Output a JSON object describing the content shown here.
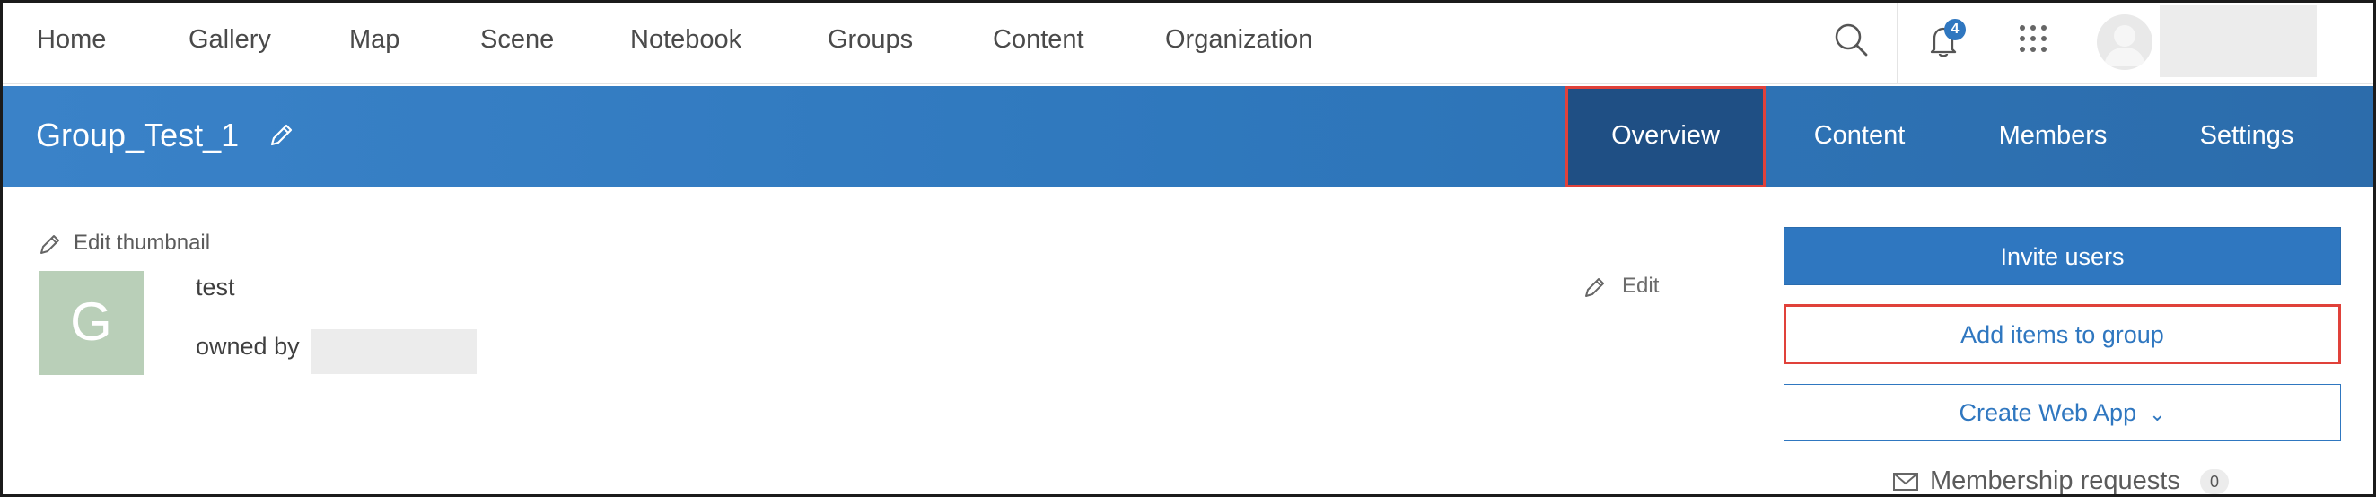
{
  "topnav": {
    "items": [
      {
        "label": "Home"
      },
      {
        "label": "Gallery"
      },
      {
        "label": "Map"
      },
      {
        "label": "Scene"
      },
      {
        "label": "Notebook"
      },
      {
        "label": "Groups"
      },
      {
        "label": "Content"
      },
      {
        "label": "Organization"
      }
    ],
    "notification_count": "4",
    "icons": [
      "search-icon",
      "bell-icon",
      "app-launcher-icon",
      "user-avatar-icon"
    ]
  },
  "group": {
    "title": "Group_Test_1",
    "tabs": [
      {
        "label": "Overview",
        "active": true
      },
      {
        "label": "Content",
        "active": false
      },
      {
        "label": "Members",
        "active": false
      },
      {
        "label": "Settings",
        "active": false
      }
    ],
    "edit_thumbnail_label": "Edit thumbnail",
    "thumbnail_letter": "G",
    "description": "test",
    "owned_by_label": "owned by",
    "edit_label": "Edit"
  },
  "actions": {
    "invite_users": "Invite users",
    "add_items": "Add items to group",
    "create_web_app": "Create Web App",
    "membership_requests": "Membership requests",
    "membership_count": "0"
  },
  "colors": {
    "accent": "#2f77c0",
    "header_bar": "#2f78bd",
    "active_tab": "#1f4f84",
    "highlight": "#e0413a",
    "thumbnail_bg": "#b9cfb8"
  }
}
